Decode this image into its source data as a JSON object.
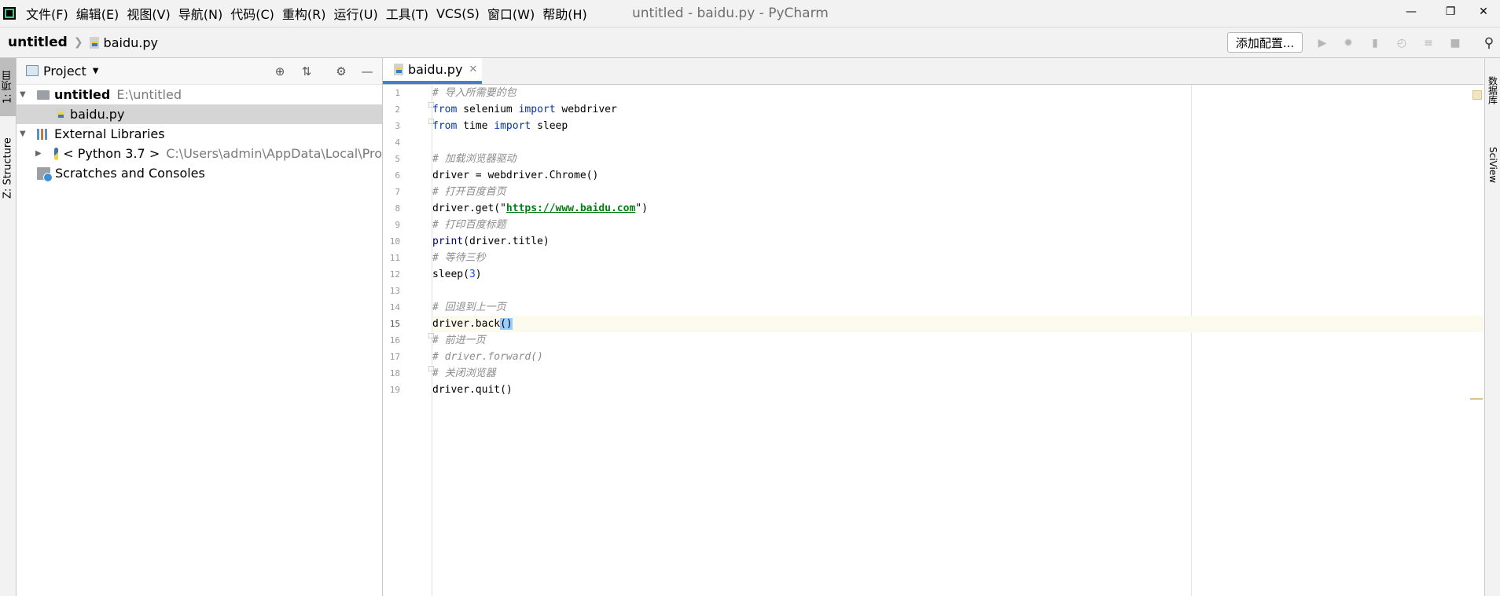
{
  "menu": {
    "items": [
      "文件(F)",
      "编辑(E)",
      "视图(V)",
      "导航(N)",
      "代码(C)",
      "重构(R)",
      "运行(U)",
      "工具(T)",
      "VCS(S)",
      "窗口(W)",
      "帮助(H)"
    ],
    "window_title": "untitled - baidu.py - PyCharm"
  },
  "navbar": {
    "project": "untitled",
    "file": "baidu.py",
    "run_config": "添加配置..."
  },
  "left_strip": {
    "project_tab": "1: 项目",
    "structure_tab": "Z: Structure"
  },
  "right_strip": {
    "database_tab": "数据库",
    "sciview_tab": "SciView"
  },
  "project_panel": {
    "title": "Project",
    "tree": [
      {
        "label": "untitled",
        "detail": "E:\\untitled"
      },
      {
        "label": "baidu.py",
        "detail": ""
      },
      {
        "label": "External Libraries",
        "detail": ""
      },
      {
        "label": "< Python 3.7 >",
        "detail": "C:\\Users\\admin\\AppData\\Local\\Pro"
      },
      {
        "label": "Scratches and Consoles",
        "detail": ""
      }
    ]
  },
  "editor": {
    "tab_label": "baidu.py",
    "current_line": 15,
    "lines": [
      "# 导入所需要的包",
      "from selenium import webdriver",
      "from time import sleep",
      "",
      "# 加载浏览器驱动",
      "driver = webdriver.Chrome()",
      "# 打开百度首页",
      "driver.get(\"https://www.baidu.com\")",
      "# 打印百度标题",
      "print(driver.title)",
      "# 等待三秒",
      "sleep(3)",
      "",
      "# 回退到上一页",
      "driver.back()",
      "# 前进一页",
      "# driver.forward()",
      "# 关闭浏览器",
      "driver.quit()"
    ],
    "line_numbers": [
      "1",
      "2",
      "3",
      "4",
      "5",
      "6",
      "7",
      "8",
      "9",
      "10",
      "11",
      "12",
      "13",
      "14",
      "15",
      "16",
      "17",
      "18",
      "19"
    ]
  }
}
